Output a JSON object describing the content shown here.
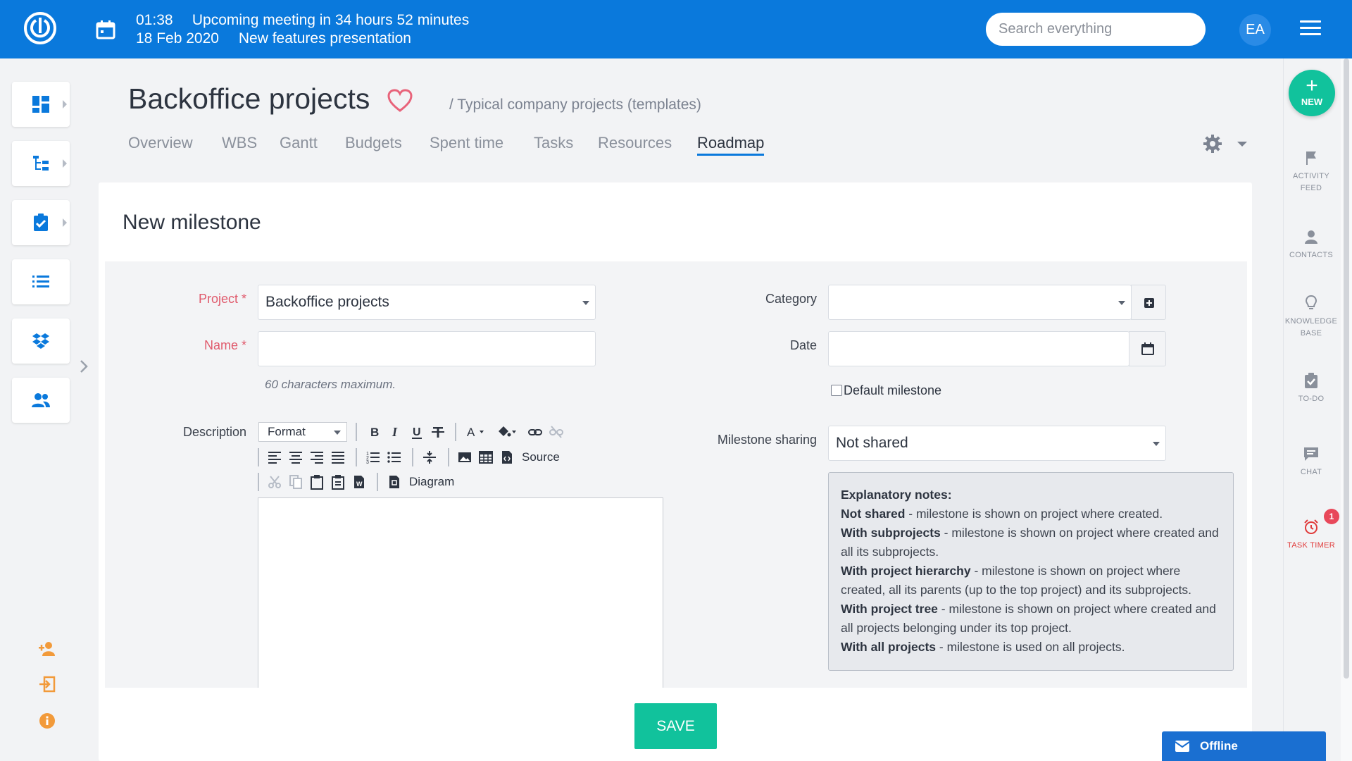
{
  "topbar": {
    "meeting_time": "01:38",
    "meeting_text": "Upcoming meeting in 34 hours 52 minutes",
    "meeting_date": "18 Feb 2020",
    "meeting_title": "New features presentation",
    "search_placeholder": "Search everything",
    "avatar_initials": "EA",
    "bg_color": "#0a79dc"
  },
  "header": {
    "project_title": "Backoffice projects",
    "breadcrumb": "/ Typical company projects (templates)",
    "tabs": [
      {
        "label": "Overview"
      },
      {
        "label": "WBS"
      },
      {
        "label": "Gantt"
      },
      {
        "label": "Budgets"
      },
      {
        "label": "Spent time"
      },
      {
        "label": "Tasks"
      },
      {
        "label": "Resources"
      },
      {
        "label": "Roadmap",
        "active": true
      }
    ]
  },
  "form": {
    "title": "New milestone",
    "project_label": "Project *",
    "project_value": "Backoffice projects",
    "name_label": "Name *",
    "name_value": "",
    "name_hint": "60 characters maximum.",
    "description_label": "Description",
    "editor": {
      "format_label": "Format",
      "source_label": "Source",
      "diagram_label": "Diagram"
    },
    "category_label": "Category",
    "category_value": "",
    "date_label": "Date",
    "date_value": "",
    "default_milestone_label": "Default milestone",
    "default_milestone_checked": false,
    "sharing_label": "Milestone sharing",
    "sharing_value": "Not shared",
    "notes": {
      "heading": "Explanatory notes:",
      "items": [
        {
          "term": "Not shared",
          "desc": " - milestone is shown on project where created."
        },
        {
          "term": "With subprojects",
          "desc": " - milestone is shown on project where created and all its subprojects."
        },
        {
          "term": "With project hierarchy",
          "desc": " - milestone is shown on project where created, all its parents (up to the top project) and its subprojects."
        },
        {
          "term": "With project tree",
          "desc": " - milestone is shown on project where created and all projects belonging under its top project."
        },
        {
          "term": "With all projects",
          "desc": " - milestone is used on all projects."
        }
      ]
    },
    "save_label": "SAVE"
  },
  "right_sidebar": {
    "new_label": "NEW",
    "items": [
      {
        "label1": "ACTIVITY",
        "label2": "FEED",
        "icon": "flag-icon"
      },
      {
        "label1": "CONTACTS",
        "label2": "",
        "icon": "person-icon"
      },
      {
        "label1": "KNOWLEDGE",
        "label2": "BASE",
        "icon": "lightbulb-icon"
      },
      {
        "label1": "TO-DO",
        "label2": "",
        "icon": "clipboard-check-icon"
      },
      {
        "label1": "CHAT",
        "label2": "",
        "icon": "chat-icon"
      },
      {
        "label1": "TASK TIMER",
        "label2": "",
        "icon": "alarm-clock-icon"
      }
    ],
    "task_timer_badge": "1"
  },
  "chat_widget": {
    "label": "Offline"
  },
  "colors": {
    "accent": "#0a79dc",
    "save": "#11c29c",
    "required": "#e05a6c",
    "timer_red": "#e03a3a"
  }
}
